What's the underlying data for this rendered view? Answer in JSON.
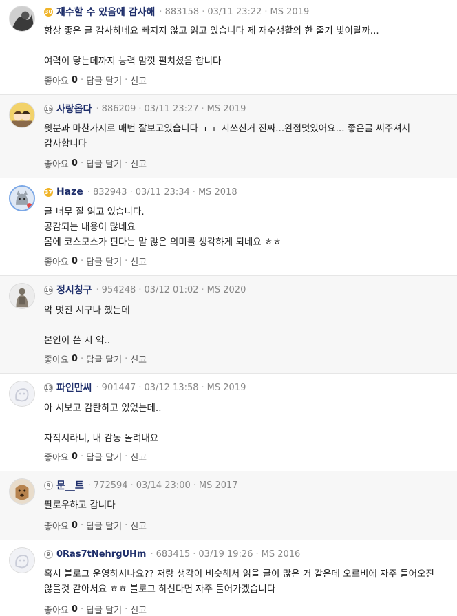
{
  "actions": {
    "like": "좋아요",
    "reply": "답글 달기",
    "report": "신고"
  },
  "comments": [
    {
      "nick": "재수할 수 있음에 감사해",
      "level": "30",
      "user_id": "883158",
      "date": "03/11 23:22",
      "ms": "MS 2019",
      "body": "항상 좋은 글 감사하네요 빠지지 않고 읽고 있습니다 제 재수생활의 한 줄기 빛이랄까...\n\n여력이 닿는데까지 능력 맘껏 펼치셨음 합니다",
      "likes": "0"
    },
    {
      "nick": "사랑옵다",
      "level": "15",
      "user_id": "886209",
      "date": "03/11 23:27",
      "ms": "MS 2019",
      "body": "윗분과 마찬가지로 매번 잘보고있습니다 ㅜㅜ 시쓰신거 진짜...완점멋있어요... 좋은글 써주셔서 감사합니다",
      "likes": "0"
    },
    {
      "nick": "Haze",
      "level": "37",
      "user_id": "832943",
      "date": "03/11 23:34",
      "ms": "MS 2018",
      "body": "글 너무 잘 읽고 있습니다.\n공감되는 내용이 많네요\n몸에 코스모스가 핀다는 말 많은 의미를 생각하게 되네요 ㅎㅎ",
      "likes": "0"
    },
    {
      "nick": "정시칭구",
      "level": "16",
      "user_id": "954248",
      "date": "03/12 01:02",
      "ms": "MS 2020",
      "body": "악 멋진 시구나 했는데\n\n본인이 쓴 시 약..",
      "likes": "0"
    },
    {
      "nick": "파인만씨",
      "level": "13",
      "user_id": "901447",
      "date": "03/12 13:58",
      "ms": "MS 2019",
      "body": "아 시보고 감탄하고 있었는데..\n\n자작시라니, 내 감동 돌려내요",
      "likes": "0"
    },
    {
      "nick": "문__트",
      "level": "9",
      "user_id": "772594",
      "date": "03/14 23:00",
      "ms": "MS 2017",
      "body": "팔로우하고 갑니다",
      "likes": "0"
    },
    {
      "nick": "0Ras7tNehrgUHm",
      "level": "9",
      "user_id": "683415",
      "date": "03/19 19:26",
      "ms": "MS 2016",
      "body": "혹시 블로그 운영하시나요?? 저랑 생각이 비슷해서 읽을 글이 많은 거 같은데 오르비에 자주 들어오진 않을것 같아서요 ㅎㅎ 블로그 하신다면 자주 들어가겠습니다",
      "likes": "0"
    }
  ]
}
